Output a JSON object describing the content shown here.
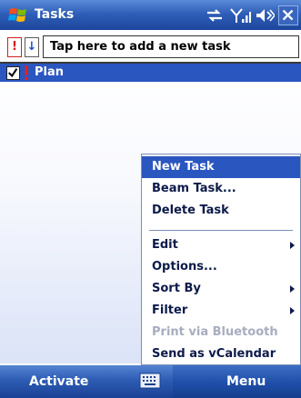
{
  "titlebar": {
    "title": "Tasks",
    "icons": [
      "windows-start-icon",
      "connectivity-icon",
      "signal-icon",
      "volume-icon",
      "close-icon"
    ]
  },
  "entry": {
    "placeholder": "Tap here to add a new task",
    "high_priority_label": "!",
    "low_priority_label": "↓"
  },
  "tasks": [
    {
      "name": "Plan",
      "checked": true,
      "priority": "high",
      "selected": true
    }
  ],
  "menu": {
    "items": [
      {
        "label": "New Task",
        "selected": true,
        "submenu": false,
        "enabled": true
      },
      {
        "label": "Beam Task...",
        "selected": false,
        "submenu": false,
        "enabled": true
      },
      {
        "label": "Delete Task",
        "selected": false,
        "submenu": false,
        "enabled": true
      },
      {
        "label": "Edit",
        "selected": false,
        "submenu": true,
        "enabled": true
      },
      {
        "label": "Options...",
        "selected": false,
        "submenu": false,
        "enabled": true
      },
      {
        "label": "Sort By",
        "selected": false,
        "submenu": true,
        "enabled": true
      },
      {
        "label": "Filter",
        "selected": false,
        "submenu": true,
        "enabled": true
      },
      {
        "label": "Print via Bluetooth",
        "selected": false,
        "submenu": false,
        "enabled": false
      },
      {
        "label": "Send as vCalendar",
        "selected": false,
        "submenu": false,
        "enabled": true
      }
    ]
  },
  "softkeys": {
    "left": "Activate",
    "right": "Menu",
    "keyboard_icon": "keyboard-icon"
  },
  "colors": {
    "titlebar": "#2f5fb8",
    "selection": "#2a56c0",
    "menu_text": "#0c1a4a",
    "disabled_text": "#a7adbe",
    "priority_high": "#d11111",
    "priority_low": "#1b4fd0"
  }
}
